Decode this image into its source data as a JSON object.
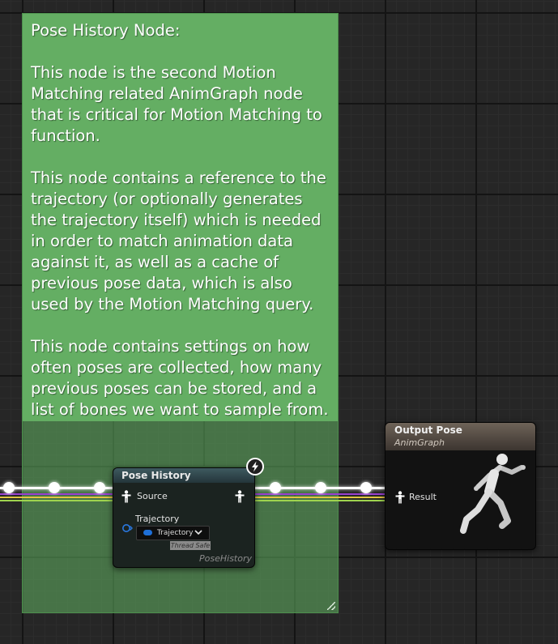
{
  "comment": {
    "text": "Pose History Node:\n\nThis node is the second Motion Matching related AnimGraph node that is critical for Motion Matching to function.\n\nThis node contains a reference to the trajectory (or optionally generates the trajectory itself) which is needed in order to match animation data against it, as well as a cache of previous pose data, which is also used by the Motion Matching query.\n\nThis node contains settings on how often poses are collected, how many previous poses can be stored, and a list of bones we want to sample from.",
    "color": "#64ae63"
  },
  "pose_history_node": {
    "title": "Pose History",
    "source_pin_label": "Source",
    "trajectory_pin_label": "Trajectory",
    "trajectory_value": "Trajectory",
    "thread_safe_label": "Thread Safe",
    "footer_label": "PoseHistory",
    "header_color": "#3e5a60",
    "icons": [
      "pose-pin-icon",
      "lightning-bolt-icon",
      "struct-pin-icon",
      "chevron-down-icon"
    ]
  },
  "output_pose_node": {
    "title": "Output Pose",
    "subtitle": "AnimGraph",
    "result_pin_label": "Result",
    "header_color": "#6e6358",
    "icons": [
      "pose-pin-icon",
      "running-mannequin-icon"
    ]
  },
  "wire_colors": [
    "#ffffff",
    "#9a3fd0",
    "#e0c640",
    "#9fd44f"
  ]
}
